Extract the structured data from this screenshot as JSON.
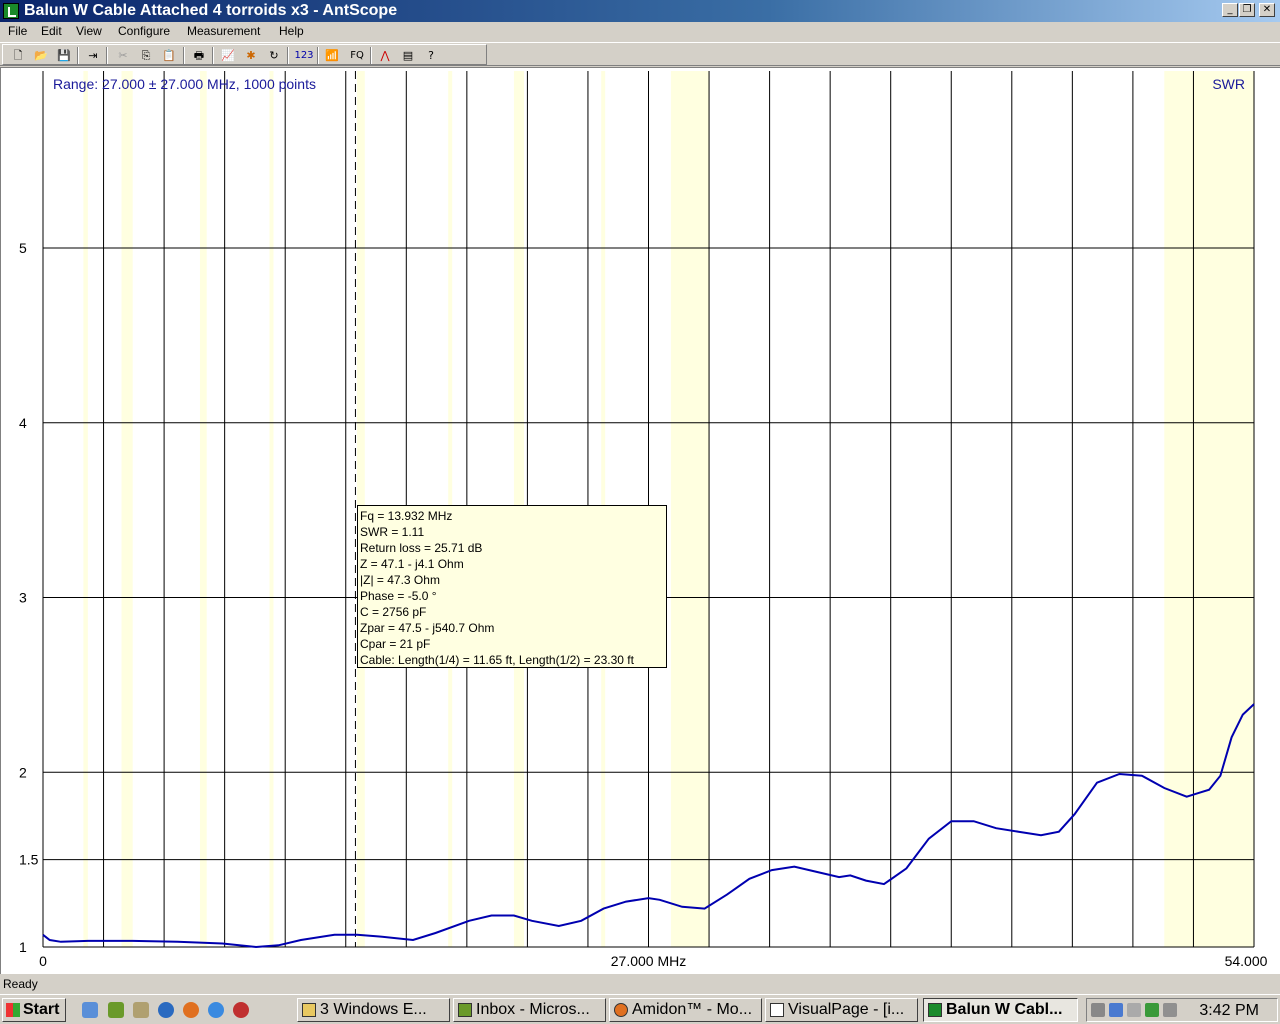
{
  "window": {
    "title": "Balun W Cable Attached 4 torroids x3 - AntScope",
    "controls": [
      "_",
      "❐",
      "✕"
    ]
  },
  "menu": [
    "File",
    "Edit",
    "View",
    "Configure",
    "Measurement",
    "Help"
  ],
  "toolbar": {
    "label_123": "123",
    "label_fq": "FQ"
  },
  "colors": {
    "trace": "#0000b0",
    "band_highlight": "#ffffe0",
    "label_blue": "#1a1a9a"
  },
  "chart_data": {
    "type": "line",
    "range_label": "Range: 27.000 ± 27.000 MHz, 1000 points",
    "mode_label": "SWR",
    "xlim": [
      0,
      54
    ],
    "ylim": [
      1,
      6
    ],
    "x_tick_labels": [
      "0",
      "27.000 MHz",
      "54.000"
    ],
    "y_tick_labels": [
      "1",
      "1.5",
      "2",
      "3",
      "4",
      "5"
    ],
    "y_ticks": [
      1,
      1.5,
      2,
      3,
      4,
      5
    ],
    "highlight_bands_mhz": [
      [
        1.8,
        2.0
      ],
      [
        3.5,
        4.0
      ],
      [
        7.0,
        7.3
      ],
      [
        10.1,
        10.15
      ],
      [
        14.0,
        14.35
      ],
      [
        18.068,
        18.168
      ],
      [
        21.0,
        21.45
      ],
      [
        24.89,
        24.99
      ],
      [
        28.0,
        29.7
      ],
      [
        50.0,
        54.0
      ]
    ],
    "marker_mhz": 13.932,
    "series": [
      {
        "x": [
          0,
          0.3,
          0.8,
          2,
          4,
          6,
          8,
          9.5,
          10.5,
          11.5,
          13,
          14,
          15,
          16.5,
          17.5,
          19,
          20,
          21,
          21.8,
          23,
          24,
          25,
          26,
          27,
          27.5,
          28.5,
          29.5,
          30.5,
          31.5,
          32.5,
          33.5,
          34.5,
          35.5,
          36,
          36.7,
          37.5,
          38.5,
          39.5,
          40.5,
          41.5,
          42.5,
          43.5,
          44.5,
          45.3,
          46,
          47,
          48,
          49,
          50,
          51,
          51.5,
          52,
          52.5,
          53,
          53.5,
          54
        ],
        "values": [
          1.07,
          1.04,
          1.03,
          1.035,
          1.035,
          1.03,
          1.02,
          1.0,
          1.01,
          1.04,
          1.07,
          1.07,
          1.06,
          1.04,
          1.08,
          1.15,
          1.18,
          1.18,
          1.15,
          1.12,
          1.15,
          1.22,
          1.26,
          1.28,
          1.27,
          1.23,
          1.22,
          1.3,
          1.39,
          1.44,
          1.46,
          1.43,
          1.4,
          1.41,
          1.38,
          1.36,
          1.45,
          1.62,
          1.72,
          1.72,
          1.68,
          1.66,
          1.64,
          1.66,
          1.76,
          1.94,
          1.99,
          1.98,
          1.91,
          1.86,
          1.88,
          1.9,
          1.98,
          2.2,
          2.33,
          2.39
        ]
      }
    ]
  },
  "tooltip": {
    "lines": [
      "Fq = 13.932 MHz",
      "SWR = 1.11",
      "Return loss = 25.71 dB",
      "Z = 47.1 - j4.1 Ohm",
      "|Z| = 47.3 Ohm",
      "Phase = -5.0 °",
      "C = 2756 pF",
      "Zpar = 47.5 - j540.7 Ohm",
      "Cpar = 21 pF",
      "Cable: Length(1/4) = 11.65 ft, Length(1/2) = 23.30 ft"
    ]
  },
  "status": "Ready",
  "taskbar": {
    "start": "Start",
    "tasks": [
      {
        "label": "3 Windows E...",
        "active": false
      },
      {
        "label": "Inbox - Micros...",
        "active": false
      },
      {
        "label": "Amidon™ - Mo...",
        "active": false
      },
      {
        "label": "VisualPage - [i...",
        "active": false
      },
      {
        "label": "Balun W Cabl...",
        "active": true
      }
    ],
    "clock": "3:42 PM"
  }
}
